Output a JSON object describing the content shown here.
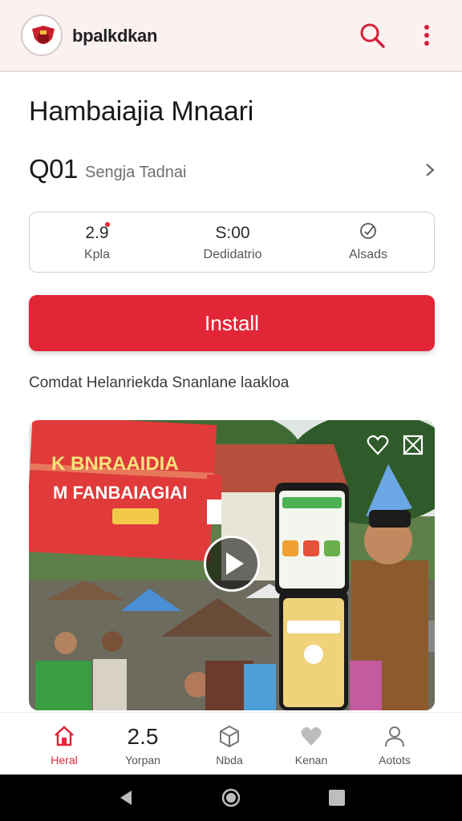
{
  "appbar": {
    "app_name": "bpalkdkan",
    "logo_icon": "crest-logo-icon",
    "search_icon": "search-icon",
    "more_icon": "more-vert-icon",
    "accent": "#e32637"
  },
  "app": {
    "title": "Hambaiajia Mnaari",
    "rating": "Q01",
    "subtitle": "Sengja Tadnai"
  },
  "stats": [
    {
      "value": "2.9",
      "label": "Kpla"
    },
    {
      "value": "S:00",
      "label": "Dedidatrio"
    },
    {
      "value": "",
      "label": "Alsads",
      "icon": "circle-check-icon"
    }
  ],
  "install_label": "Install",
  "description": "Comdat Helanriekda Snanlane laakloa",
  "media": {
    "banner_line1": "K BNRAAIDIA",
    "banner_line2": "M FANBAIAGIAI",
    "favorite_icon": "heart-icon",
    "close_icon": "close-box-icon",
    "play_icon": "play-icon"
  },
  "bottom_nav": [
    {
      "label": "Heral",
      "icon": "home-icon",
      "active": true
    },
    {
      "label": "Yorpan",
      "big_value": "2.5"
    },
    {
      "label": "Nbda",
      "icon": "box-icon"
    },
    {
      "label": "Kenan",
      "icon": "heart-icon"
    },
    {
      "label": "Aotots",
      "icon": "person-icon"
    }
  ],
  "system_nav": [
    "back-icon",
    "home-circle-icon",
    "recents-icon"
  ]
}
